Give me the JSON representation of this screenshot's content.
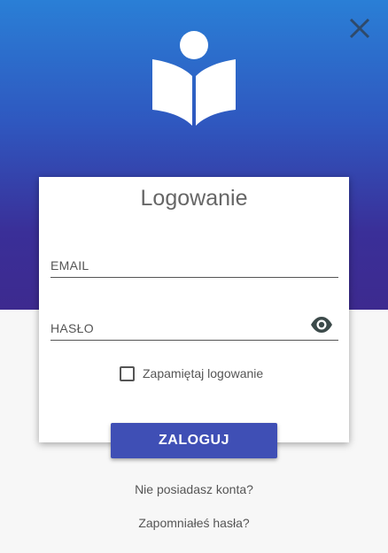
{
  "header": {
    "close_icon": "close-icon",
    "logo_icon": "reading-person-book-icon"
  },
  "login_form": {
    "title": "Logowanie",
    "email": {
      "placeholder": "EMAIL",
      "value": ""
    },
    "password": {
      "placeholder": "HASŁO",
      "value": "",
      "toggle_icon": "eye-icon"
    },
    "remember": {
      "label": "Zapamiętaj logowanie",
      "checked": false
    },
    "submit_label": "ZALOGUJ"
  },
  "links": {
    "register": "Nie posiadasz konta?",
    "forgot_password": "Zapomniałeś hasła?"
  },
  "colors": {
    "gradient_top": "#2a7fd6",
    "gradient_bottom": "#3d2a8f",
    "button": "#3f4fb5",
    "background": "#f7f7f7"
  }
}
